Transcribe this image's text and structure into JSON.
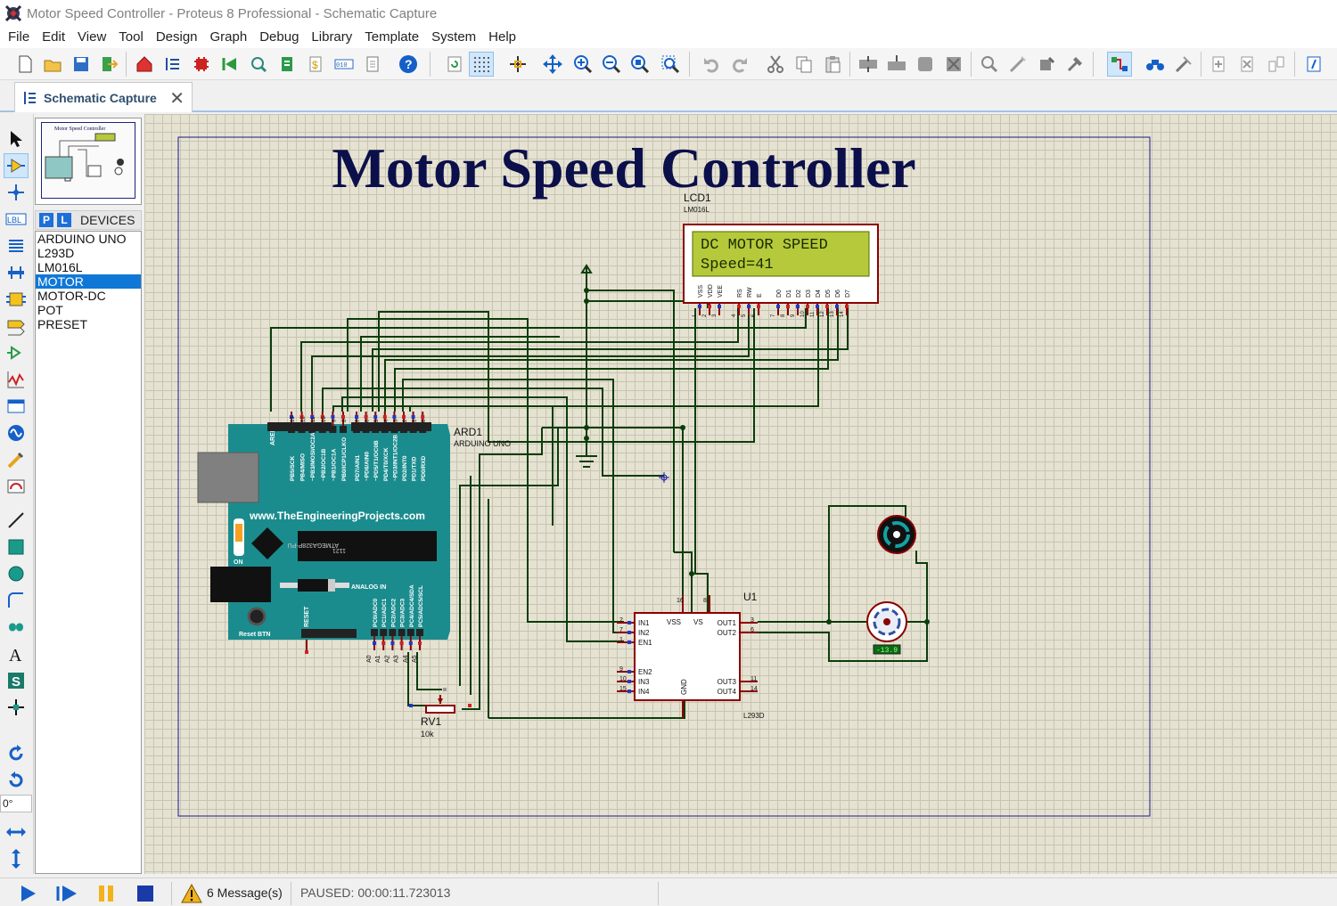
{
  "window": {
    "title": "Motor Speed Controller - Proteus 8 Professional - Schematic Capture"
  },
  "menu": [
    "File",
    "Edit",
    "View",
    "Tool",
    "Design",
    "Graph",
    "Debug",
    "Library",
    "Template",
    "System",
    "Help"
  ],
  "tab": {
    "label": "Schematic Capture",
    "close": "✕"
  },
  "overview": {
    "caption": "Motor Speed Controller"
  },
  "devices": {
    "p_label": "P",
    "l_label": "L",
    "title": "DEVICES",
    "items": [
      "ARDUINO UNO",
      "L293D",
      "LM016L",
      "MOTOR",
      "MOTOR-DC",
      "POT",
      "PRESET"
    ],
    "selected": "MOTOR"
  },
  "rotation": {
    "angle": "0°"
  },
  "schematic": {
    "title": "Motor Speed Controller",
    "lcd": {
      "ref": "LCD1",
      "part": "LM016L",
      "line1": "DC MOTOR SPEED",
      "line2": "Speed=41",
      "pins": [
        "VSS",
        "VDD",
        "VEE",
        "RS",
        "RW",
        "E",
        "D0",
        "D1",
        "D2",
        "D3",
        "D4",
        "D5",
        "D6",
        "D7"
      ],
      "pin_numbers": [
        "1",
        "2",
        "3",
        "4",
        "5",
        "6",
        "7",
        "8",
        "9",
        "10",
        "11",
        "12",
        "13",
        "14"
      ]
    },
    "arduino": {
      "ref": "ARD1",
      "part": "ARDUINO UNO",
      "website": "www.TheEngineeringProjects.com",
      "chip": "ATMEGA328P-PU",
      "chip_code": "1121",
      "on_label": "ON",
      "analog_label": "ANALOG IN",
      "reset_btn": "Reset BTN",
      "reset_pin": "RESET",
      "aref": "AREF",
      "top_left_pins": [
        "PB5/SCK",
        "PB4/MISO",
        "~PB3/MOSI/OC2A",
        "~PB2/OC1B",
        "~PB1/OC1A",
        "PB0/ICP1/CLKO"
      ],
      "top_right_pins": [
        "PD7/AIN1",
        "~PD6/AIN0",
        "~PD5/T1/OC0B",
        "PD4/T0/XCK",
        "~PD3/INT1/OC2B",
        "PD2/INT0",
        "PD1/TXD",
        "PD0/RXD"
      ],
      "top_left_nums": [
        "13",
        "12",
        "11",
        "10",
        "9",
        "8"
      ],
      "top_right_nums": [
        "7",
        "6",
        "5",
        "4",
        "3",
        "2",
        "1",
        "0"
      ],
      "analog_pins": [
        "PC0/ADC0",
        "PC1/ADC1",
        "PC2/ADC2",
        "PC3/ADC3",
        "PC4/ADC4/SDA",
        "PC5/ADC5/SCL"
      ],
      "analog_nums": [
        "A0",
        "A1",
        "A2",
        "A3",
        "A4",
        "A5"
      ]
    },
    "driver": {
      "ref": "U1",
      "part": "L293D",
      "left_pins": [
        "IN1",
        "IN2",
        "EN1",
        "EN2",
        "IN3",
        "IN4"
      ],
      "left_nums": [
        "2",
        "7",
        "1",
        "9",
        "10",
        "15"
      ],
      "right_pins": [
        "OUT1",
        "OUT2",
        "OUT3",
        "OUT4"
      ],
      "right_nums": [
        "3",
        "6",
        "11",
        "14"
      ],
      "top_pins": [
        "VSS",
        "VS"
      ],
      "top_nums": [
        "16",
        "8"
      ],
      "gnd": "GND"
    },
    "pot": {
      "ref": "RV1",
      "value": "10k"
    },
    "motor_speed": "-13.9"
  },
  "status": {
    "messages": "6 Message(s)",
    "text": "PAUSED: 00:00:11.723013"
  },
  "colors": {
    "title_navy": "#0b0f4a",
    "lcd_green": "#b5c93a",
    "arduino_teal": "#1b8c8e",
    "wire": "#0a3d0a",
    "component_red": "#8b0000"
  }
}
